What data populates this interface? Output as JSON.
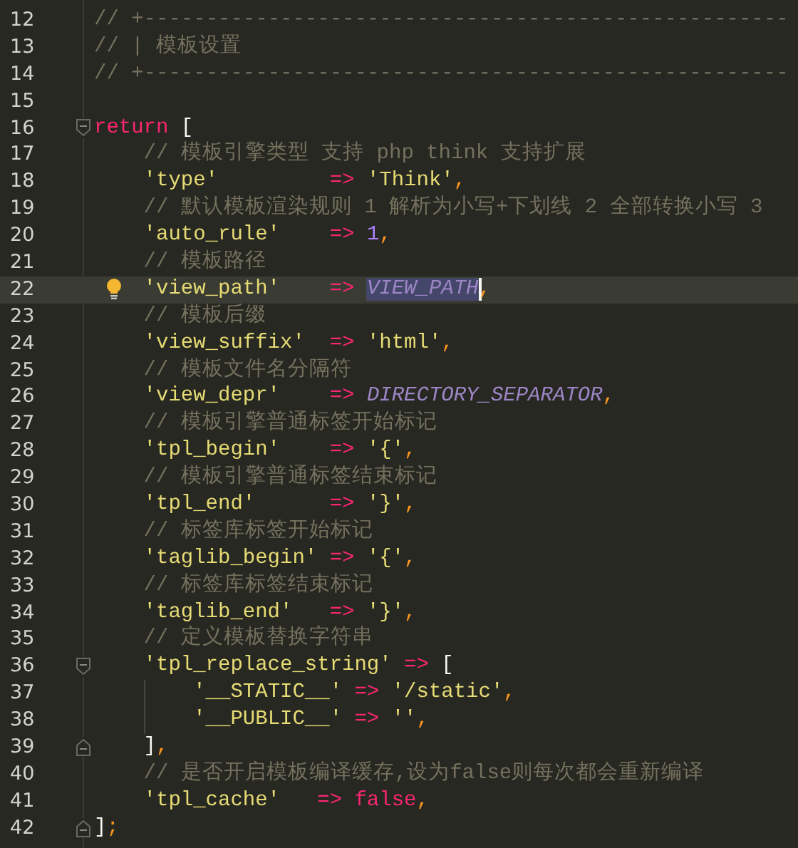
{
  "editor": {
    "lines": [
      {
        "number": "12",
        "current": false,
        "tokens": [
          {
            "kind": "comment",
            "text": "// +----------------------------------------------------"
          }
        ]
      },
      {
        "number": "13",
        "current": false,
        "tokens": [
          {
            "kind": "comment",
            "text": "// | 模板设置"
          }
        ]
      },
      {
        "number": "14",
        "current": false,
        "tokens": [
          {
            "kind": "comment",
            "text": "// +----------------------------------------------------"
          }
        ]
      },
      {
        "number": "15",
        "current": false
      },
      {
        "number": "16",
        "current": false,
        "fold_start": true,
        "tokens": [
          {
            "kind": "keyword",
            "text": "return"
          },
          {
            "kind": "bracket",
            "text": " ["
          }
        ],
        "children": [
          {
            "number": "17",
            "current": false,
            "tokens": [
              {
                "kind": "comment",
                "text": "// 模板引擎类型 支持 php think 支持扩展"
              }
            ]
          },
          {
            "number": "18",
            "current": false,
            "tokens": [
              {
                "kind": "string",
                "text": "'type'"
              },
              {
                "kind": "op",
                "text": "         => "
              },
              {
                "kind": "string",
                "text": "'Think'"
              },
              {
                "kind": "punct",
                "text": ","
              }
            ]
          },
          {
            "number": "19",
            "current": false,
            "tokens": [
              {
                "kind": "comment",
                "text": "// 默认模板渲染规则 1 解析为小写+下划线 2 全部转换小写 3"
              }
            ]
          },
          {
            "number": "20",
            "current": false,
            "tokens": [
              {
                "kind": "string",
                "text": "'auto_rule'"
              },
              {
                "kind": "op",
                "text": "    => "
              },
              {
                "kind": "number",
                "text": "1"
              },
              {
                "kind": "punct",
                "text": ","
              }
            ]
          },
          {
            "number": "21",
            "current": false,
            "tokens": [
              {
                "kind": "comment",
                "text": "// 模板路径"
              }
            ]
          },
          {
            "number": "22",
            "current": true,
            "hint": true,
            "tokens": [
              {
                "kind": "string",
                "text": "'view_path'"
              },
              {
                "kind": "op",
                "text": "    => "
              },
              {
                "kind": "constant",
                "text": "VIEW_PATH",
                "selected": true
              },
              {
                "kind": "punct",
                "text": ","
              }
            ]
          },
          {
            "number": "23",
            "current": false,
            "tokens": [
              {
                "kind": "comment",
                "text": "// 模板后缀"
              }
            ]
          },
          {
            "number": "24",
            "current": false,
            "tokens": [
              {
                "kind": "string",
                "text": "'view_suffix'"
              },
              {
                "kind": "op",
                "text": "  => "
              },
              {
                "kind": "string",
                "text": "'html'"
              },
              {
                "kind": "punct",
                "text": ","
              }
            ]
          },
          {
            "number": "25",
            "current": false,
            "tokens": [
              {
                "kind": "comment",
                "text": "// 模板文件名分隔符"
              }
            ]
          },
          {
            "number": "26",
            "current": false,
            "tokens": [
              {
                "kind": "string",
                "text": "'view_depr'"
              },
              {
                "kind": "op",
                "text": "    => "
              },
              {
                "kind": "constant",
                "text": "DIRECTORY_SEPARATOR"
              },
              {
                "kind": "punct",
                "text": ","
              }
            ]
          },
          {
            "number": "27",
            "current": false,
            "tokens": [
              {
                "kind": "comment",
                "text": "// 模板引擎普通标签开始标记"
              }
            ]
          },
          {
            "number": "28",
            "current": false,
            "tokens": [
              {
                "kind": "string",
                "text": "'tpl_begin'"
              },
              {
                "kind": "op",
                "text": "    => "
              },
              {
                "kind": "string",
                "text": "'{'"
              },
              {
                "kind": "punct",
                "text": ","
              }
            ]
          },
          {
            "number": "29",
            "current": false,
            "tokens": [
              {
                "kind": "comment",
                "text": "// 模板引擎普通标签结束标记"
              }
            ]
          },
          {
            "number": "30",
            "current": false,
            "tokens": [
              {
                "kind": "string",
                "text": "'tpl_end'"
              },
              {
                "kind": "op",
                "text": "      => "
              },
              {
                "kind": "string",
                "text": "'}'"
              },
              {
                "kind": "punct",
                "text": ","
              }
            ]
          },
          {
            "number": "31",
            "current": false,
            "tokens": [
              {
                "kind": "comment",
                "text": "// 标签库标签开始标记"
              }
            ]
          },
          {
            "number": "32",
            "current": false,
            "tokens": [
              {
                "kind": "string",
                "text": "'taglib_begin'"
              },
              {
                "kind": "op",
                "text": " => "
              },
              {
                "kind": "string",
                "text": "'{'"
              },
              {
                "kind": "punct",
                "text": ","
              }
            ]
          },
          {
            "number": "33",
            "current": false,
            "tokens": [
              {
                "kind": "comment",
                "text": "// 标签库标签结束标记"
              }
            ]
          },
          {
            "number": "34",
            "current": false,
            "tokens": [
              {
                "kind": "string",
                "text": "'taglib_end'"
              },
              {
                "kind": "op",
                "text": "   => "
              },
              {
                "kind": "string",
                "text": "'}'"
              },
              {
                "kind": "punct",
                "text": ","
              }
            ]
          },
          {
            "number": "35",
            "current": false,
            "tokens": [
              {
                "kind": "comment",
                "text": "// 定义模板替换字符串"
              }
            ]
          },
          {
            "number": "36",
            "current": false,
            "fold_start": true,
            "tokens": [
              {
                "kind": "string",
                "text": "'tpl_replace_string'"
              },
              {
                "kind": "op",
                "text": " => "
              },
              {
                "kind": "bracket",
                "text": "["
              }
            ],
            "children": [
              {
                "number": "37",
                "current": false,
                "tokens": [
                  {
                    "kind": "string",
                    "text": "'__STATIC__'"
                  },
                  {
                    "kind": "op",
                    "text": " => "
                  },
                  {
                    "kind": "string",
                    "text": "'/static'"
                  },
                  {
                    "kind": "punct",
                    "text": ","
                  }
                ]
              },
              {
                "number": "38",
                "current": false,
                "tokens": [
                  {
                    "kind": "string",
                    "text": "'__PUBLIC__'"
                  },
                  {
                    "kind": "op",
                    "text": " => "
                  },
                  {
                    "kind": "string",
                    "text": "''"
                  },
                  {
                    "kind": "punct",
                    "text": ","
                  }
                ]
              }
            ]
          },
          {
            "number": "39",
            "current": false,
            "fold_end": true,
            "tokens": [
              {
                "kind": "bracket",
                "text": "]"
              },
              {
                "kind": "punct",
                "text": ","
              }
            ]
          },
          {
            "number": "40",
            "current": false,
            "tokens": [
              {
                "kind": "comment",
                "text": "// 是否开启模板编译缓存,设为false则每次都会重新编译"
              }
            ]
          },
          {
            "number": "41",
            "current": false,
            "tokens": [
              {
                "kind": "string",
                "text": "'tpl_cache'"
              },
              {
                "kind": "op",
                "text": "   => "
              },
              {
                "kind": "keyword",
                "text": "false"
              },
              {
                "kind": "punct",
                "text": ","
              }
            ]
          }
        ]
      },
      {
        "number": "42",
        "current": false,
        "fold_end": true,
        "tokens": [
          {
            "kind": "bracket",
            "text": "]"
          },
          {
            "kind": "punct",
            "text": ";"
          }
        ]
      }
    ]
  }
}
